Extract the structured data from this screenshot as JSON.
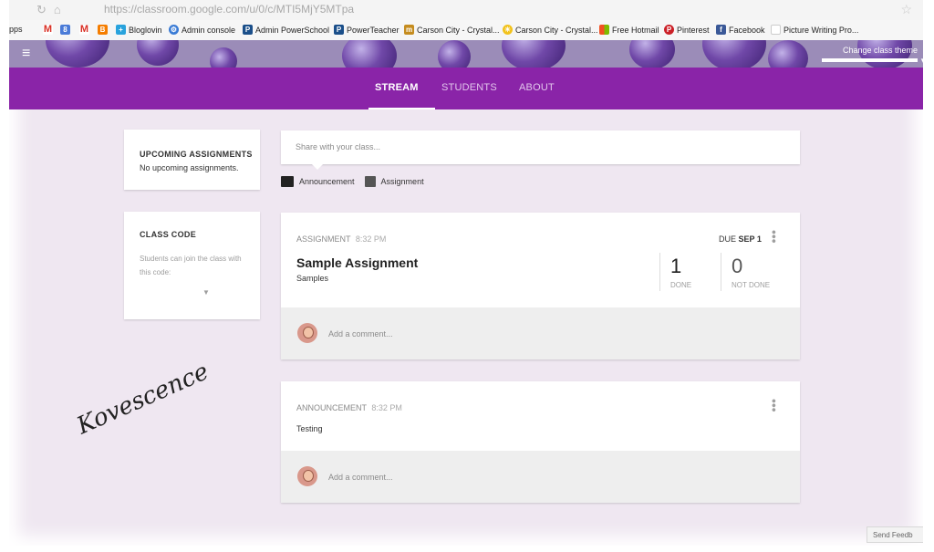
{
  "browser": {
    "url": "https://classroom.google.com/u/0/c/MTI5MjY5MTpa",
    "bookmarks": [
      {
        "label": "pps",
        "icon": "apps-icon",
        "color": "#4285f4"
      },
      {
        "label": "",
        "icon": "gmail-icon",
        "color": "#d93025"
      },
      {
        "label": "",
        "icon": "google-plus-icon",
        "color": "#4a7bd8"
      },
      {
        "label": "",
        "icon": "gmail-icon",
        "color": "#d93025"
      },
      {
        "label": "",
        "icon": "blogger-icon",
        "color": "#f57d00"
      },
      {
        "label": "Bloglovin",
        "icon": "bloglovin-icon",
        "color": "#29a3dd"
      },
      {
        "label": "Admin console",
        "icon": "google-admin-icon",
        "color": "#3a7bd5"
      },
      {
        "label": "Admin PowerSchool",
        "icon": "powerschool-icon",
        "color": "#1b4f8a"
      },
      {
        "label": "PowerTeacher",
        "icon": "powerschool-icon",
        "color": "#1b4f8a"
      },
      {
        "label": "Carson City - Crystal...",
        "icon": "ccsd-icon",
        "color": "#c58c1f"
      },
      {
        "label": "Carson City - Crystal...",
        "icon": "sun-icon",
        "color": "#f2c21b"
      },
      {
        "label": "Free Hotmail",
        "icon": "windows-icon",
        "color": "#f25022"
      },
      {
        "label": "Pinterest",
        "icon": "pinterest-icon",
        "color": "#cb2027"
      },
      {
        "label": "Facebook",
        "icon": "facebook-icon",
        "color": "#3b5998"
      },
      {
        "label": "Picture Writing Pro...",
        "icon": "page-icon",
        "color": "#7f8c8d"
      }
    ]
  },
  "banner": {
    "change_theme": "Change class theme"
  },
  "tabs": [
    {
      "label": "STREAM",
      "active": true
    },
    {
      "label": "STUDENTS",
      "active": false
    },
    {
      "label": "ABOUT",
      "active": false
    }
  ],
  "sidebar": {
    "upcoming_title": "UPCOMING ASSIGNMENTS",
    "upcoming_text": "No upcoming assignments.",
    "class_code_title": "CLASS CODE",
    "class_code_text": "Students can join the class with this code:"
  },
  "share": {
    "placeholder": "Share with your class...",
    "announcement_label": "Announcement",
    "assignment_label": "Assignment"
  },
  "posts": {
    "assignment": {
      "type": "ASSIGNMENT",
      "time": "8:32 PM",
      "due_prefix": "DUE",
      "due_date": "SEP 1",
      "title": "Sample Assignment",
      "subtitle": "Samples",
      "done_count": "1",
      "done_label": "DONE",
      "not_done_count": "0",
      "not_done_label": "NOT DONE",
      "comment_placeholder": "Add a comment..."
    },
    "announcement": {
      "type": "ANNOUNCEMENT",
      "time": "8:32 PM",
      "body": "Testing",
      "comment_placeholder": "Add a comment..."
    }
  },
  "signature": "Kovescence",
  "feedback": "Send Feedb"
}
